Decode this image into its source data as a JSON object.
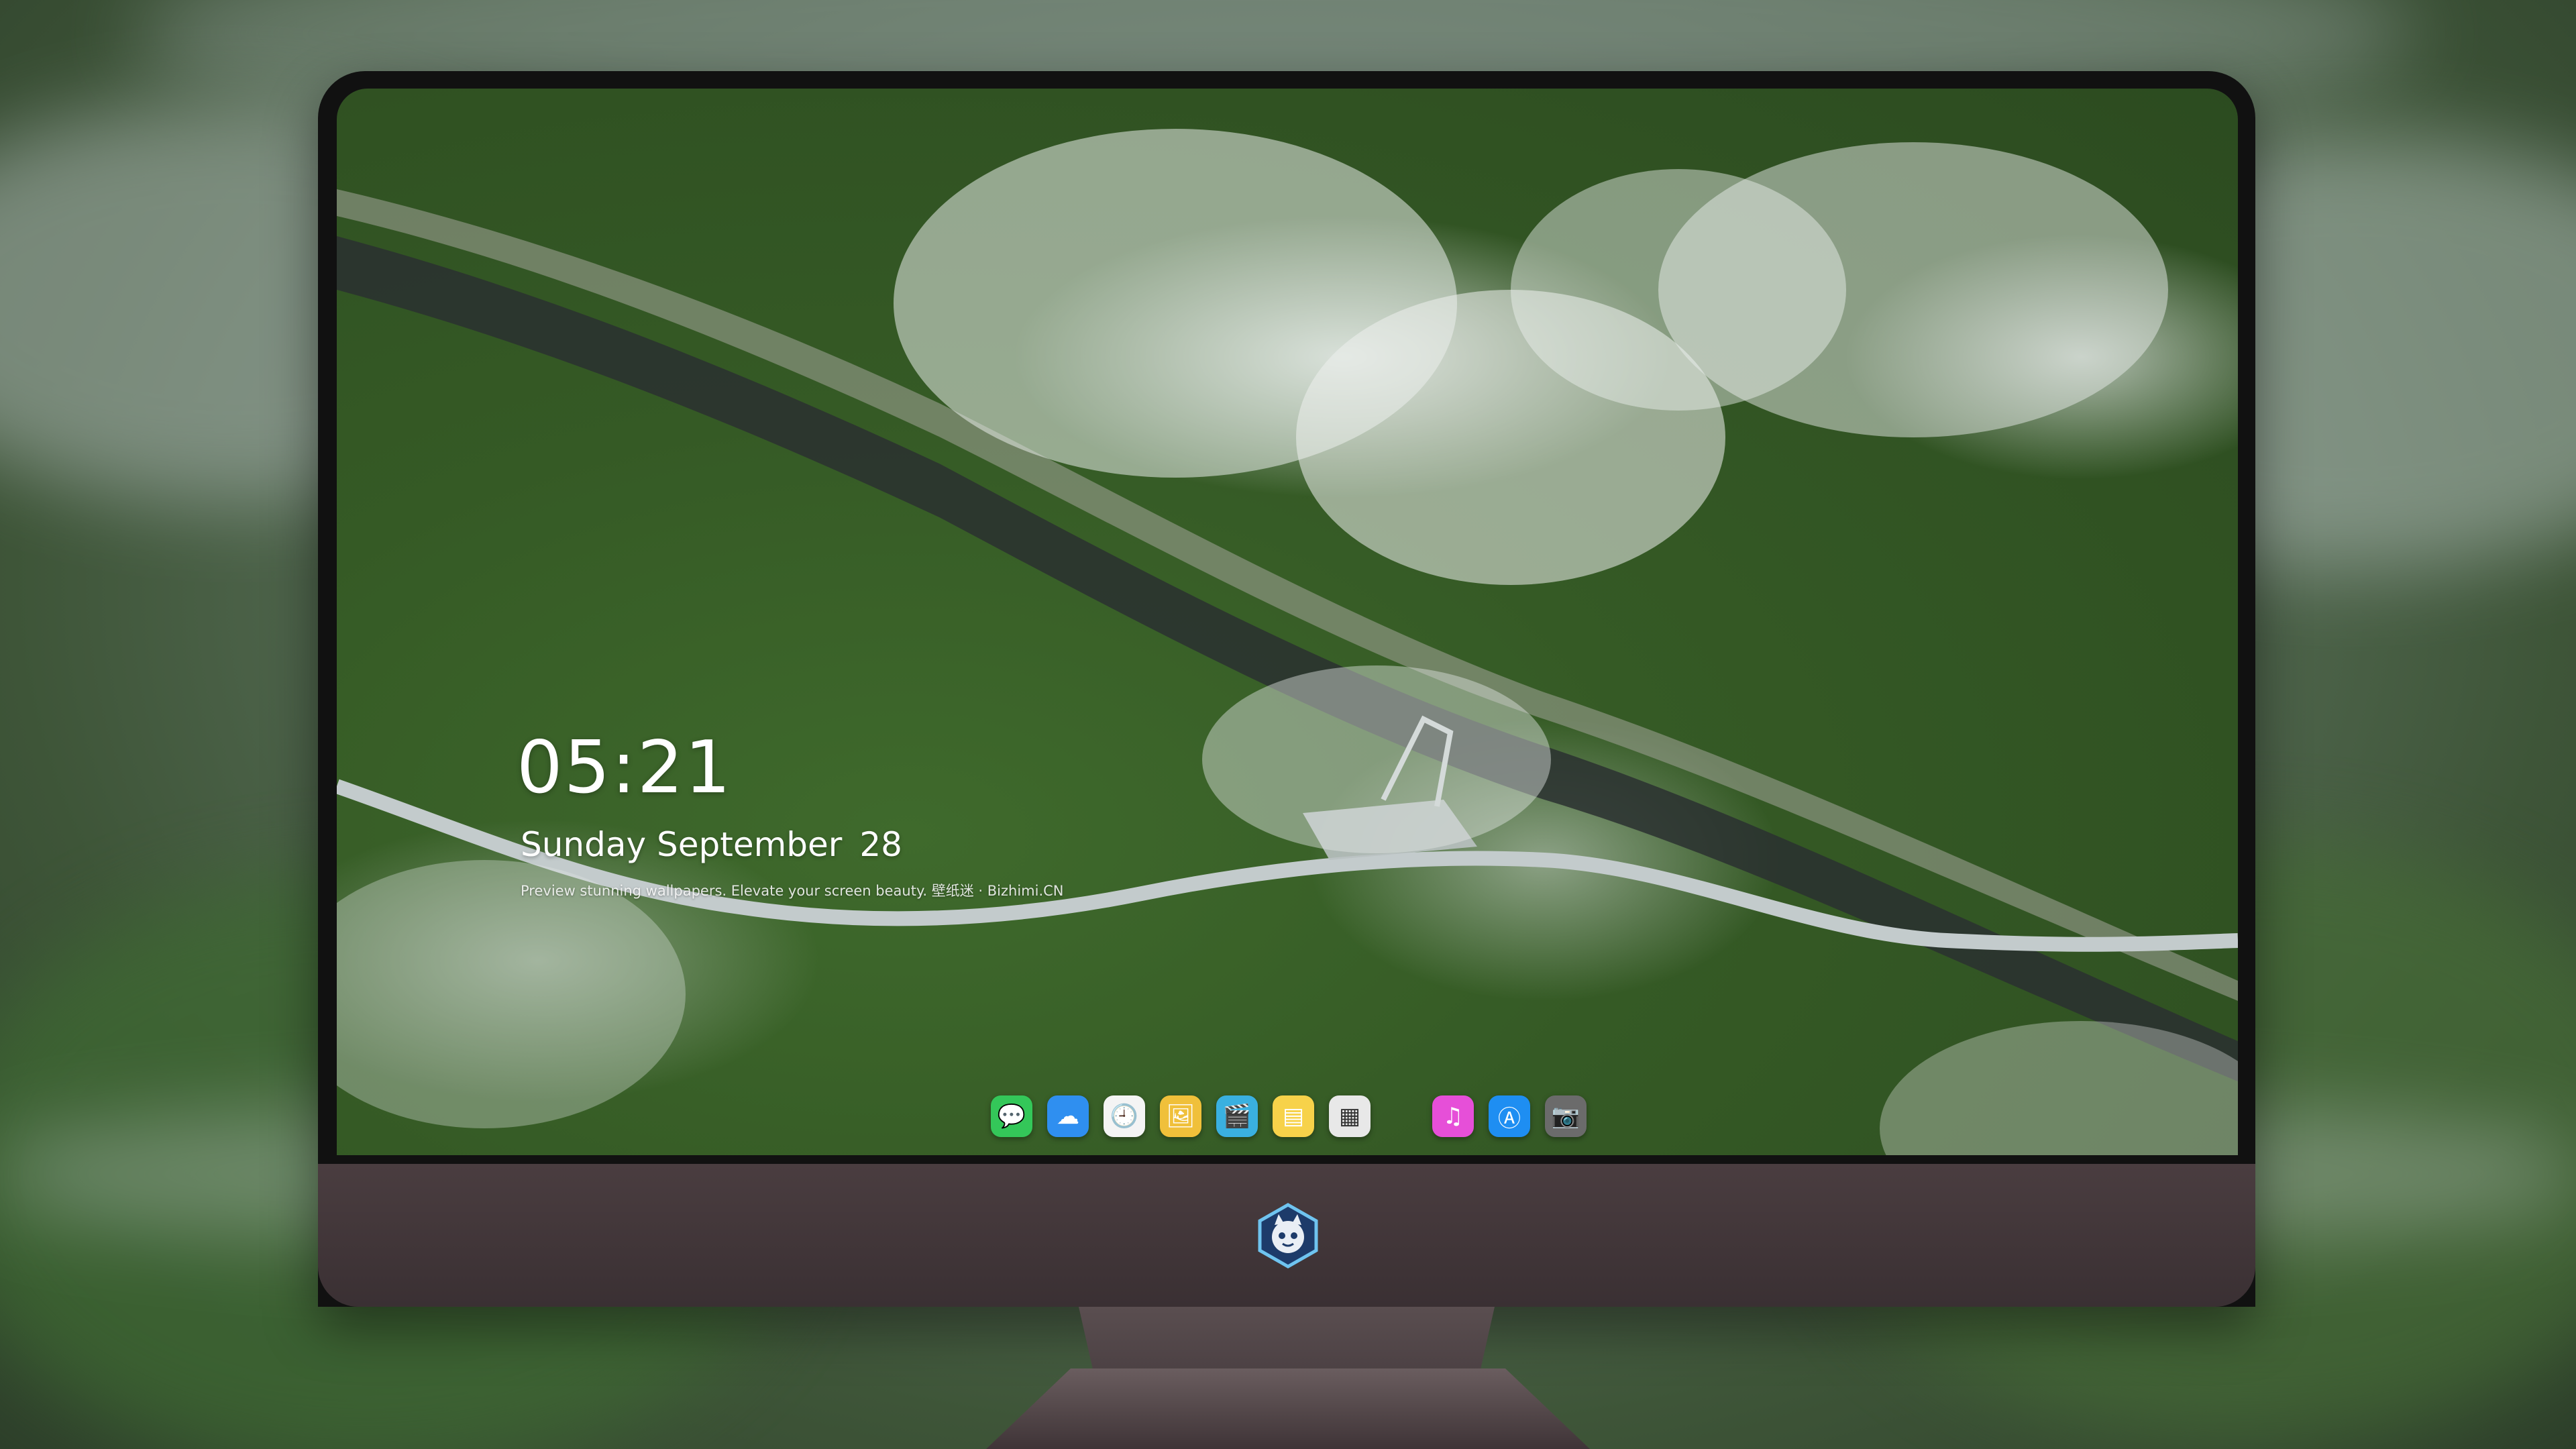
{
  "lock_screen": {
    "time": "05:21",
    "day_month": "Sunday September",
    "day_number": "28",
    "caption": "Preview stunning wallpapers. Elevate your screen beauty. 壁纸迷 · Bizhimi.CN"
  },
  "dock": {
    "apps": [
      {
        "name": "messages-icon",
        "color": "#34c759"
      },
      {
        "name": "weather-icon",
        "color": "#2f8ff0"
      },
      {
        "name": "clock-icon",
        "color": "#f4f4f4"
      },
      {
        "name": "preview-icon",
        "color": "#f0c03a"
      },
      {
        "name": "video-icon",
        "color": "#3ab0e0"
      },
      {
        "name": "notes-icon",
        "color": "#f7d24a"
      },
      {
        "name": "photo-icon",
        "color": "#e8e8e8"
      },
      {
        "name": "music-icon",
        "color": "#e64fd8"
      },
      {
        "name": "app-store-icon",
        "color": "#1e8ef2"
      },
      {
        "name": "camera-icon",
        "color": "#6b6b6b"
      }
    ]
  },
  "monitor": {
    "chin_color": "#3f3437",
    "logo": "mascot-logo"
  }
}
